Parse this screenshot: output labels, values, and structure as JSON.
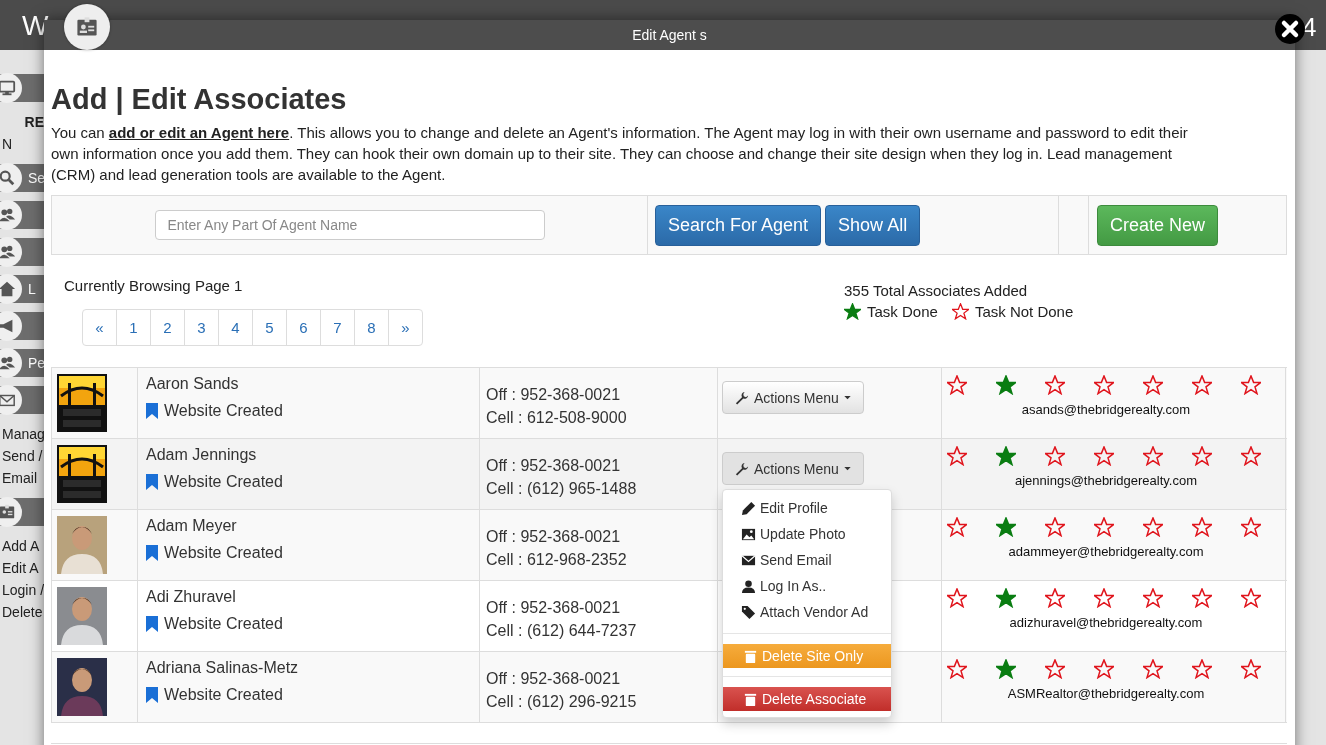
{
  "background": {
    "logo_fragment": "W",
    "corner_fragment": "4",
    "sidebar": [
      {
        "kind": "monitor"
      },
      {
        "kind": "title",
        "text": "RE"
      },
      {
        "kind": "link",
        "text": "N"
      },
      {
        "kind": "search",
        "text": "Se"
      },
      {
        "kind": "people"
      },
      {
        "kind": "people"
      },
      {
        "kind": "home",
        "text": "L"
      },
      {
        "kind": "megaphone"
      },
      {
        "kind": "people",
        "text": "Pe"
      },
      {
        "kind": "envelope"
      },
      {
        "kind": "link",
        "text": "Manag"
      },
      {
        "kind": "link",
        "text": "Send /"
      },
      {
        "kind": "link",
        "text": "Email"
      },
      {
        "kind": "idcard"
      },
      {
        "kind": "link",
        "text": "Add A"
      },
      {
        "kind": "link",
        "text": "Edit A"
      },
      {
        "kind": "link",
        "text": "Login /"
      },
      {
        "kind": "link",
        "text": "Delete"
      }
    ]
  },
  "window": {
    "title": "Edit Agent s"
  },
  "heading": "Add | Edit Associates",
  "intro": "You can **add or edit an Agent here**. This allows you to change and delete an Agent's information. The Agent may log in with their own username and password to edit their own information once you add them. They can hook their own domain up to their site. They can choose and change their site design when they log in. Lead management (CRM) and lead generation tools are available to the Agent.",
  "search": {
    "placeholder": "Enter Any Part Of Agent Name",
    "buttons": [
      "Search For Agent",
      "Show All"
    ],
    "create_button": "Create New"
  },
  "browsing": "Currently Browsing Page 1",
  "pagination": [
    {
      "label": "«",
      "selected": false
    },
    {
      "label": "1",
      "selected": false
    },
    {
      "label": "2",
      "selected": false
    },
    {
      "label": "3",
      "selected": false
    },
    {
      "label": "4",
      "selected": false
    },
    {
      "label": "5",
      "selected": false
    },
    {
      "label": "6",
      "selected": false
    },
    {
      "label": "7",
      "selected": false
    },
    {
      "label": "8",
      "selected": false
    },
    {
      "label": "»",
      "selected": false
    }
  ],
  "total": "355 Total Associates Added",
  "legend": [
    {
      "label": "Task Done",
      "done": true
    },
    {
      "label": "Task Not Done",
      "done": false
    }
  ],
  "actions_menu": {
    "items": [
      {
        "kind": "link",
        "label": "Edit Profile"
      },
      {
        "kind": "link",
        "label": "Update Photo"
      },
      {
        "kind": "link",
        "label": "Send Email"
      },
      {
        "kind": "link",
        "label": "Log In As.."
      },
      {
        "kind": "link",
        "label": "Attach Vendor Ad"
      },
      {
        "kind": "warning",
        "label": "Delete Site Only"
      },
      {
        "kind": "danger",
        "label": "Delete Associate"
      }
    ]
  },
  "rows": [
    {
      "photo": {
        "kind": "logo"
      },
      "name": "Aaron Sands",
      "status": "Website Created",
      "office": "Off : 952-368-0021",
      "cell": "Cell : 612-508-9000",
      "actions": "Actions Menu",
      "menu_open": false,
      "highlighted": false,
      "tasks_done": [
        false,
        true,
        false,
        false,
        false,
        false,
        false
      ],
      "email": "asands@thebridgerealty.com"
    },
    {
      "photo": {
        "kind": "logo"
      },
      "name": "Adam Jennings",
      "status": "Website Created",
      "office": "Off : 952-368-0021",
      "cell": "Cell : (612) 965-1488",
      "actions": "Actions Menu",
      "menu_open": true,
      "highlighted": true,
      "tasks_done": [
        false,
        true,
        false,
        false,
        false,
        false,
        false
      ],
      "email": "ajennings@thebridgerealty.com"
    },
    {
      "photo": {
        "kind": "portrait"
      },
      "name": "Adam Meyer",
      "status": "Website Created",
      "office": "Off : 952-368-0021",
      "cell": "Cell : 612-968-2352",
      "menu_open": false,
      "highlighted": false,
      "tasks_done": [
        false,
        true,
        false,
        false,
        false,
        false,
        false
      ],
      "email": "adammeyer@thebridgerealty.com"
    },
    {
      "photo": {
        "kind": "portrait"
      },
      "name": "Adi Zhuravel",
      "status": "Website Created",
      "office": "Off : 952-368-0021",
      "cell": "Cell : (612) 644-7237",
      "menu_open": false,
      "highlighted": false,
      "tasks_done": [
        false,
        true,
        false,
        false,
        false,
        false,
        false
      ],
      "email": "adizhuravel@thebridgerealty.com"
    },
    {
      "photo": {
        "kind": "portrait"
      },
      "name": "Adriana Salinas-Metz",
      "status": "Website Created",
      "office": "Off : 952-368-0021",
      "cell": "Cell : (612) 296-9215",
      "menu_open": false,
      "highlighted": false,
      "tasks_done": [
        false,
        true,
        false,
        false,
        false,
        false,
        false
      ],
      "email": "ASMRealtor@thebridgerealty.com"
    }
  ]
}
